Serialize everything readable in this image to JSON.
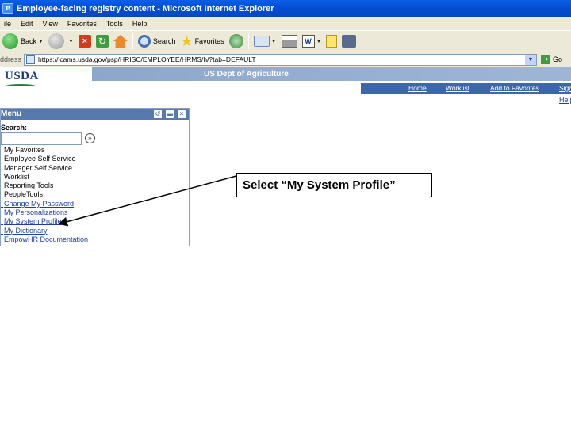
{
  "window": {
    "title": "Employee-facing registry content - Microsoft Internet Explorer"
  },
  "menubar": {
    "items": [
      "ile",
      "Edit",
      "View",
      "Favorites",
      "Tools",
      "Help"
    ]
  },
  "toolbar": {
    "back_label": "Back",
    "search_label": "Search",
    "favorites_label": "Favorites",
    "word_icon_text": "W"
  },
  "address": {
    "label": "ddress",
    "url": "https://icams.usda.gov/psp/HRISC/EMPLOYEE/HRMS/h/?tab=DEFAULT",
    "go_label": "Go"
  },
  "header": {
    "logo_text": "USDA",
    "agency": "US Dept of Agriculture",
    "nav": [
      "Home",
      "Worklist",
      "Add to Favorites",
      "Sign"
    ],
    "help": "Help"
  },
  "portlet": {
    "title": "Menu",
    "search_label": "Search:",
    "items": [
      {
        "label": "My Favorites",
        "link": false
      },
      {
        "label": "Employee Self Service",
        "link": false
      },
      {
        "label": "Manager Self Service",
        "link": false
      },
      {
        "label": "Worklist",
        "link": false
      },
      {
        "label": "Reporting Tools",
        "link": false
      },
      {
        "label": "PeopleTools",
        "link": false
      },
      {
        "label": "Change My Password",
        "link": true
      },
      {
        "label": "My Personalizations",
        "link": true
      },
      {
        "label": "My System Profile",
        "link": true
      },
      {
        "label": "My Dictionary",
        "link": true
      },
      {
        "label": "EmpowHR Documentation",
        "link": true
      }
    ]
  },
  "callout": {
    "text": "Select “My System Profile”"
  }
}
